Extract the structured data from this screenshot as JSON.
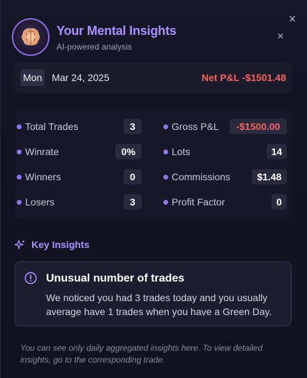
{
  "header": {
    "title": "Your Mental Insights",
    "subtitle": "AI-powered analysis",
    "close_glyph": "×"
  },
  "date_bar": {
    "day": "Mon",
    "date": "Mar 24, 2025",
    "net_pnl": "Net P&L -$1501.48"
  },
  "stats": {
    "left": [
      {
        "label": "Total Trades",
        "value": "3"
      },
      {
        "label": "Winrate",
        "value": "0%"
      },
      {
        "label": "Winners",
        "value": "0"
      },
      {
        "label": "Losers",
        "value": "3"
      }
    ],
    "right": [
      {
        "label": "Gross P&L",
        "value": "-$1500.00"
      },
      {
        "label": "Lots",
        "value": "14"
      },
      {
        "label": "Commissions",
        "value": "$1.48"
      },
      {
        "label": "Profit Factor",
        "value": "0"
      }
    ]
  },
  "key_insights": {
    "label": "Key Insights",
    "icon": "sparkle-icon",
    "cards": [
      {
        "title": "Unusual number of trades",
        "body": "We noticed you had 3 trades today and you usually average have 1 trades when you have a Green Day.",
        "icon": "info-circle-icon"
      }
    ]
  },
  "footnote": "You can see only daily aggregated insights here. To view detailed insights, go to the corresponding trade.",
  "colors": {
    "accent": "#a991ff",
    "negative": "#f06464",
    "background": "#131320"
  }
}
